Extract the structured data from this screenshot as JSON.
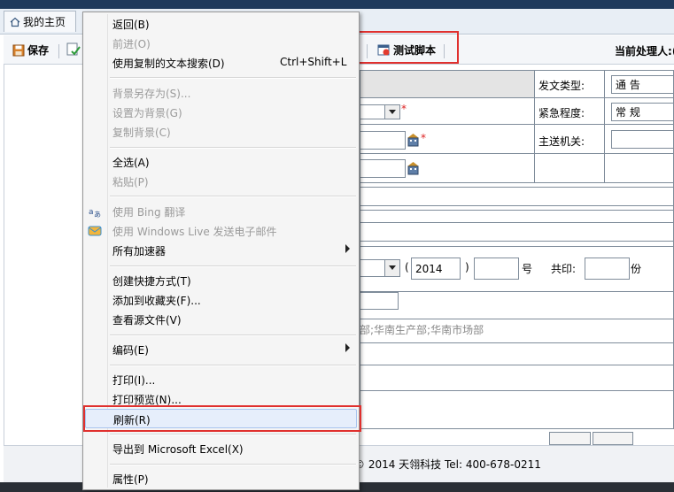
{
  "tabs": {
    "home_label": "我的主页"
  },
  "toolbar": {
    "save_label": "保存",
    "test_script_label": "测试脚本",
    "handler_label": "当前处理人:",
    "handler_partial": "("
  },
  "form": {
    "doc_type_label": "发文类型:",
    "doc_type_value": "通 告",
    "urgency_label": "紧急程度:",
    "urgency_value": "常 规",
    "recipient_label": "主送机关:",
    "required_mark": "*",
    "year_open": "(",
    "year_value": "2014",
    "year_close": ")",
    "number_unit": "号",
    "print_label": "共印:",
    "copies_unit": "份",
    "departments_text": "部;华南生产部;华南市场部"
  },
  "footer": {
    "copyright": "© 2014 天翎科技 Tel: 400-678-0211"
  },
  "menu": {
    "items": [
      {
        "label": "返回(B)"
      },
      {
        "label": "前进(O)"
      },
      {
        "label": "使用复制的文本搜索(D)",
        "shortcut": "Ctrl+Shift+L"
      },
      {
        "label": "背景另存为(S)..."
      },
      {
        "label": "设置为背景(G)"
      },
      {
        "label": "复制背景(C)"
      },
      {
        "label": "全选(A)"
      },
      {
        "label": "粘贴(P)"
      },
      {
        "label": "使用 Bing 翻译"
      },
      {
        "label": "使用 Windows Live 发送电子邮件"
      },
      {
        "label": "所有加速器"
      },
      {
        "label": "创建快捷方式(T)"
      },
      {
        "label": "添加到收藏夹(F)..."
      },
      {
        "label": "查看源文件(V)"
      },
      {
        "label": "编码(E)"
      },
      {
        "label": "打印(I)..."
      },
      {
        "label": "打印预览(N)..."
      },
      {
        "label": "刷新(R)"
      },
      {
        "label": "导出到 Microsoft Excel(X)"
      },
      {
        "label": "属性(P)"
      }
    ]
  },
  "colors": {
    "highlight_border": "#e0302e",
    "menu_bg": "#f5f5f5",
    "hover_bg": "#e6eefb"
  }
}
